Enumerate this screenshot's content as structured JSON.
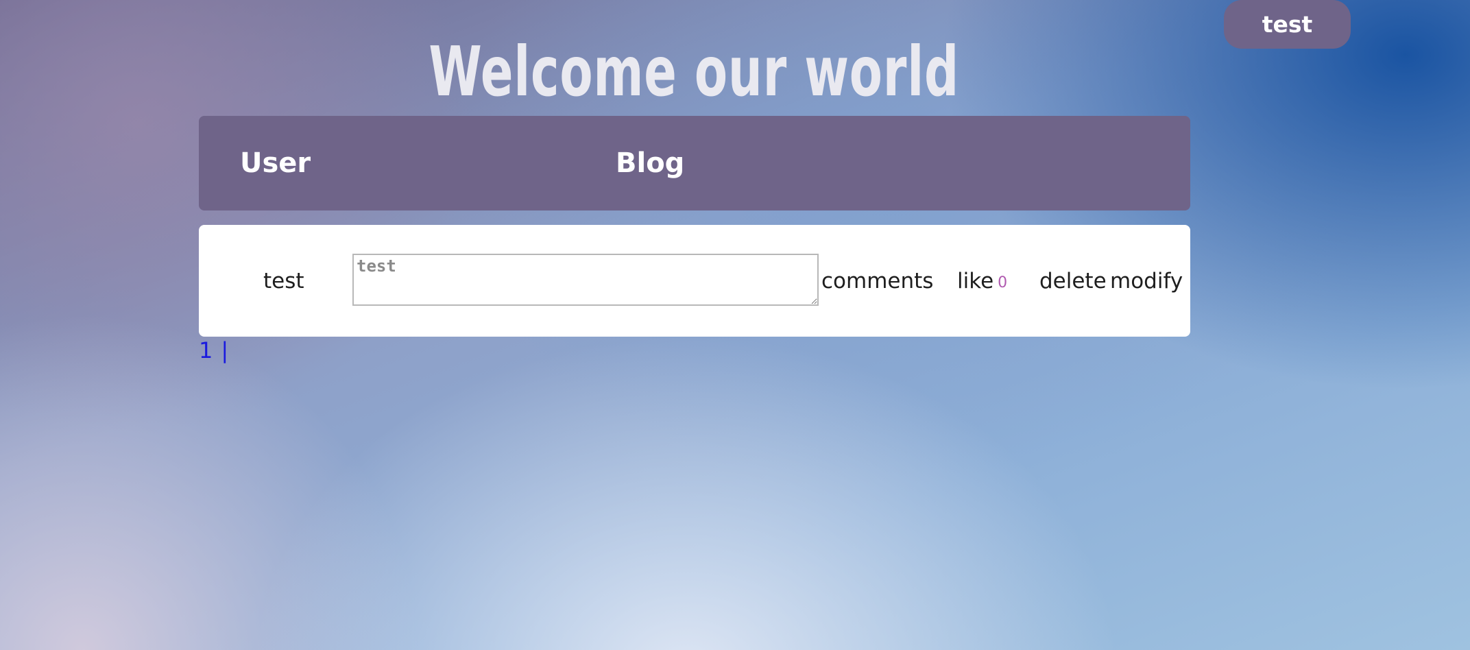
{
  "top_right": {
    "user_label": "test"
  },
  "header": {
    "title": "Welcome our world"
  },
  "table": {
    "columns": [
      "User",
      "Blog"
    ],
    "rows": [
      {
        "user": "test",
        "blog_text": "test",
        "comments_label": "comments",
        "like_label": "like",
        "like_count": "0",
        "delete_label": "delete",
        "modify_label": "modify"
      }
    ]
  },
  "pagination": {
    "pages": [
      "1"
    ],
    "separator": "|"
  },
  "colors": {
    "header_bar": "#6f6489",
    "link": "#4a4aee",
    "like_count": "#b05ab0",
    "pager": "#1a1adf"
  }
}
